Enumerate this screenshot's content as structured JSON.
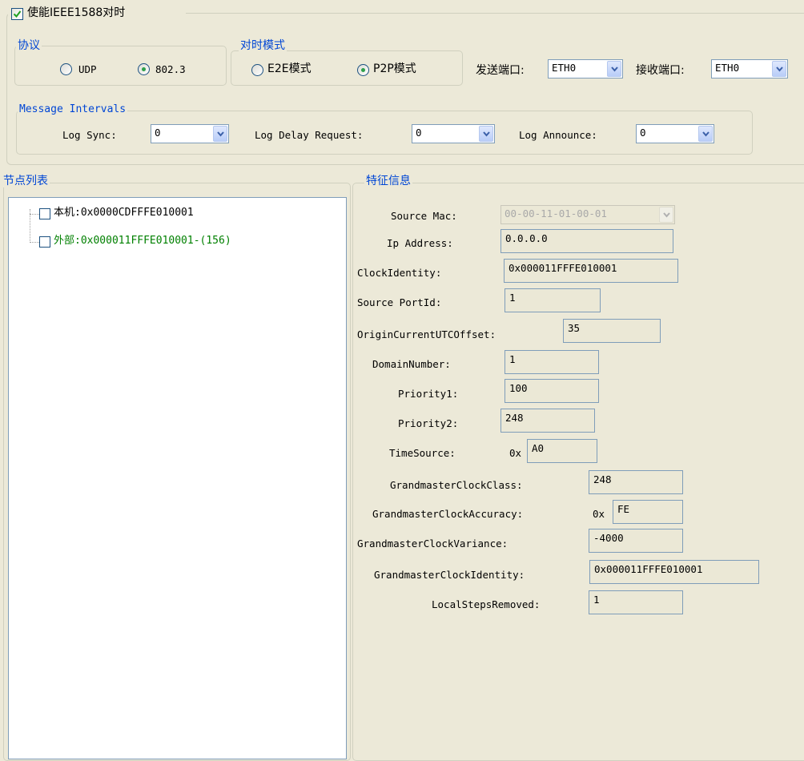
{
  "enable": {
    "label": "使能IEEE1588对时",
    "checked": true
  },
  "protocol": {
    "title": "协议",
    "options": [
      {
        "label": "UDP",
        "selected": false
      },
      {
        "label": "802.3",
        "selected": true
      }
    ]
  },
  "sync_mode": {
    "title": "对时模式",
    "options": [
      {
        "label": "E2E模式",
        "selected": false
      },
      {
        "label": "P2P模式",
        "selected": true
      }
    ]
  },
  "send_port": {
    "label": "发送端口:",
    "value": "ETH0"
  },
  "recv_port": {
    "label": "接收端口:",
    "value": "ETH0"
  },
  "intervals": {
    "title": "Message Intervals",
    "log_sync": {
      "label": "Log Sync:",
      "value": "0"
    },
    "log_delay": {
      "label": "Log Delay Request:",
      "value": "0"
    },
    "log_announce": {
      "label": "Log Announce:",
      "value": "0"
    }
  },
  "node_list": {
    "title": "节点列表",
    "items": [
      {
        "label": "本机:0x0000CDFFFE010001",
        "color": "#000000"
      },
      {
        "label": "外部:0x000011FFFE010001-(156)",
        "color": "#008000"
      }
    ]
  },
  "features": {
    "title": "特征信息",
    "source_mac": {
      "label": "Source Mac:",
      "value": "00-00-11-01-00-01"
    },
    "ip_address": {
      "label": "Ip Address:",
      "value": "0.0.0.0"
    },
    "clock_identity": {
      "label": "ClockIdentity:",
      "value": "0x000011FFFE010001"
    },
    "source_port_id": {
      "label": "Source PortId:",
      "value": "1"
    },
    "utc_offset": {
      "label": "OriginCurrentUTCOffset:",
      "value": "35"
    },
    "domain_number": {
      "label": "DomainNumber:",
      "value": "1"
    },
    "priority1": {
      "label": "Priority1:",
      "value": "100"
    },
    "priority2": {
      "label": "Priority2:",
      "value": "248"
    },
    "time_source": {
      "label": "TimeSource:",
      "prefix": "0x",
      "value": "A0"
    },
    "gm_clock_class": {
      "label": "GrandmasterClockClass:",
      "value": "248"
    },
    "gm_clock_accuracy": {
      "label": "GrandmasterClockAccuracy:",
      "prefix": "0x",
      "value": "FE"
    },
    "gm_clock_variance": {
      "label": "GrandmasterClockVariance:",
      "value": "-4000"
    },
    "gm_clock_identity": {
      "label": "GrandmasterClockIdentity:",
      "value": "0x000011FFFE010001"
    },
    "local_steps_removed": {
      "label": "LocalStepsRemoved:",
      "value": "1"
    }
  },
  "colors": {
    "group_title": "#0046d5",
    "window_bg": "#ece9d8",
    "radio_dot": "#2ea04a",
    "external_node": "#008000"
  }
}
